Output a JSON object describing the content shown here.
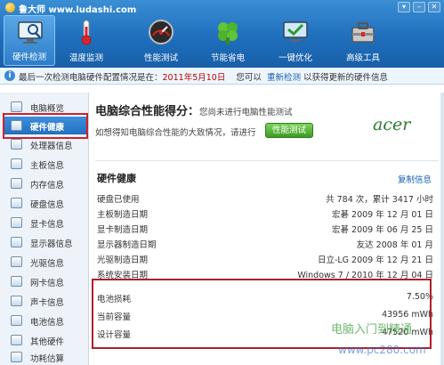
{
  "titlebar": {
    "title": "鲁大师 www.ludashi.com"
  },
  "toolbar": [
    {
      "label": "硬件检测",
      "icon": "monitor-magnifier-icon",
      "active": true
    },
    {
      "label": "温度监测",
      "icon": "thermometer-icon",
      "active": false
    },
    {
      "label": "性能测试",
      "icon": "speedometer-icon",
      "active": false
    },
    {
      "label": "节能省电",
      "icon": "leaf-icon",
      "active": false
    },
    {
      "label": "一键优化",
      "icon": "monitor-check-icon",
      "active": false
    },
    {
      "label": "高级工具",
      "icon": "toolbox-icon",
      "active": false
    }
  ],
  "infobar": {
    "prefix": "最后一次检测电脑硬件配置情况是在：",
    "date": "2011年5月10日",
    "middle": "您可以",
    "link": "重新检测",
    "suffix": "以获得更新的硬件信息"
  },
  "sidebar": [
    {
      "label": "电脑概览",
      "active": false
    },
    {
      "label": "硬件健康",
      "active": true
    },
    {
      "label": "处理器信息",
      "active": false
    },
    {
      "label": "主板信息",
      "active": false
    },
    {
      "label": "内存信息",
      "active": false
    },
    {
      "label": "硬盘信息",
      "active": false
    },
    {
      "label": "显卡信息",
      "active": false
    },
    {
      "label": "显示器信息",
      "active": false
    },
    {
      "label": "光驱信息",
      "active": false
    },
    {
      "label": "网卡信息",
      "active": false
    },
    {
      "label": "声卡信息",
      "active": false
    },
    {
      "label": "电池信息",
      "active": false
    },
    {
      "label": "其他硬件",
      "active": false
    },
    {
      "label": "功耗估算",
      "active": false
    }
  ],
  "score": {
    "title": "电脑综合性能得分：",
    "subtitle": "您尚未进行电脑性能测试",
    "hint": "如想得知电脑综合性能的大致情况，请进行",
    "button": "性能测试",
    "brand": "acer"
  },
  "health": {
    "title": "硬件健康",
    "copy_link": "复制信息",
    "rows": [
      {
        "key": "硬盘已使用",
        "value": "共 784 次，累计 3417 小时"
      },
      {
        "key": "主板制造日期",
        "value": "宏碁 2009 年 12 月 01 日"
      },
      {
        "key": "显卡制造日期",
        "value": "宏碁 2009 年 06 月 25 日"
      },
      {
        "key": "显示器制造日期",
        "value": "友达 2008 年 01 月"
      },
      {
        "key": "光驱制造日期",
        "value": "日立-LG 2009 年 12 月 21 日"
      },
      {
        "key": "系统安装日期",
        "value": "Windows 7 / 2010 年 12 月 04 日"
      }
    ],
    "battery_rows": [
      {
        "key": "电池损耗",
        "value": "7.50%"
      },
      {
        "key": "当前容量",
        "value": "43956 mWh"
      },
      {
        "key": "设计容量",
        "value": "47520 mWh"
      }
    ]
  },
  "watermark": {
    "line1": "电脑入门到精通",
    "line2": "www.pc280.com"
  }
}
